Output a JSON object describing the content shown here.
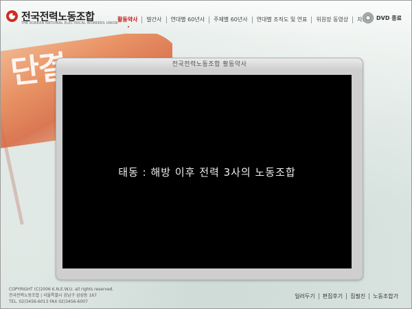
{
  "logo": {
    "title": "전국전력노동조합",
    "subtitle": "THE KOREAN NATIONAL ELECTRICAL WORKERS UNION"
  },
  "nav": {
    "items": [
      {
        "label": "활동약사",
        "active": true
      },
      {
        "label": "발간사"
      },
      {
        "label": "연대별 60년사"
      },
      {
        "label": "주제별 60년사"
      },
      {
        "label": "연대별 조직도 및 연표"
      },
      {
        "label": "위원장 동영상"
      },
      {
        "label": "자료실"
      }
    ]
  },
  "dvd_exit": {
    "label": "DVD 종료",
    "icon": "disc-icon"
  },
  "banner": {
    "text": "단결"
  },
  "panel": {
    "title": "전국전력노동조합 활동약사",
    "caption": "태동 : 해방 이후 전력 3사의 노동조합"
  },
  "footer": {
    "copyright": "COPYRIGHT (C)2006 K.N.E.W.U. all rights reserved.",
    "address": "전국전력노동조합 | 서울특별시 강남구 삼성동 167",
    "tel": "TEL. 02)3456-6013 FAX 02)3456-6007",
    "links": [
      "일러두기",
      "편집후기",
      "집필진",
      "노동조합가"
    ]
  },
  "colors": {
    "accent": "#c41a1a",
    "screen": "#000000",
    "panel": "#cfcfcf"
  }
}
